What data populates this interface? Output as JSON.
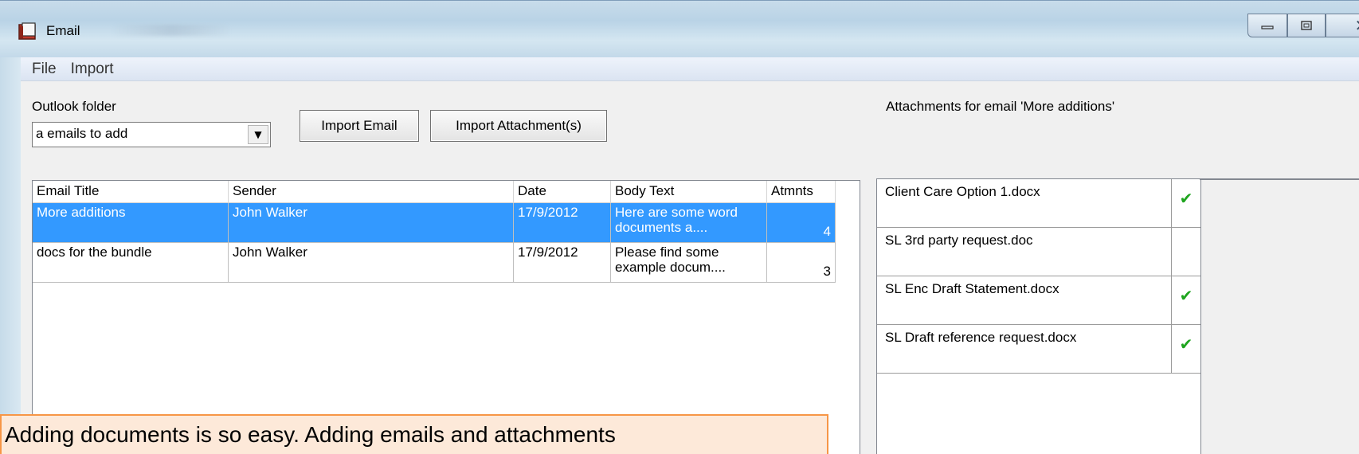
{
  "window": {
    "title": "Email",
    "controls": {
      "minimize": "—",
      "maximize": "▢",
      "close": "✕"
    }
  },
  "menu": [
    "File",
    "Import"
  ],
  "outlook_folder": {
    "label": "Outlook folder",
    "selected": "a emails to add"
  },
  "buttons": {
    "import_email": "Import Email",
    "import_attachments": "Import Attachment(s)"
  },
  "email_list": {
    "columns": [
      "Email Title",
      "Sender",
      "Date",
      "Body Text",
      "Atmnts"
    ],
    "rows": [
      {
        "title": "More additions",
        "sender": "John Walker",
        "date": "17/9/2012",
        "body": "Here are some word documents a....",
        "attachments": "4",
        "selected": true
      },
      {
        "title": "docs for the bundle",
        "sender": "John Walker",
        "date": "17/9/2012",
        "body": "Please find some example docum....",
        "attachments": "3",
        "selected": false
      }
    ]
  },
  "attachments": {
    "heading": "Attachments for email 'More additions'",
    "items": [
      {
        "name": "Client Care Option 1.docx",
        "checked": true
      },
      {
        "name": "SL 3rd party request.doc",
        "checked": false
      },
      {
        "name": "SL Enc Draft Statement.docx",
        "checked": true
      },
      {
        "name": "SL Draft reference request.docx",
        "checked": true
      }
    ]
  },
  "callout": {
    "text": "Adding documents is so easy. Adding emails and attachments"
  },
  "colors": {
    "selection": "#3399ff",
    "check": "#1fa51f",
    "callout_fill": "#fde9d9",
    "callout_border": "#f79646"
  }
}
